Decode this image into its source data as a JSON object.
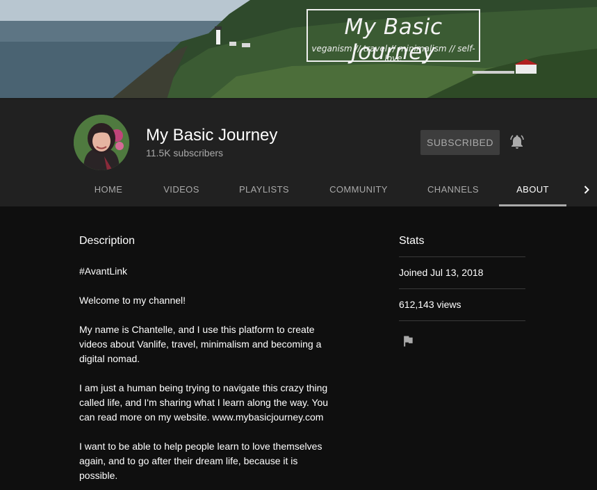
{
  "banner": {
    "title": "My Basic Journey",
    "tagline": "veganism // travel // minimalism // self-love"
  },
  "channel": {
    "name": "My Basic Journey",
    "subscribers": "11.5K subscribers",
    "subscribe_label": "SUBSCRIBED"
  },
  "tabs": [
    "HOME",
    "VIDEOS",
    "PLAYLISTS",
    "COMMUNITY",
    "CHANNELS",
    "ABOUT"
  ],
  "active_tab": "ABOUT",
  "about": {
    "description_title": "Description",
    "paragraphs": [
      [
        "#AvantLink"
      ],
      [
        "Welcome to my channel!"
      ],
      [
        "My name is Chantelle, and I use this platform to create",
        "videos about Vanlife, travel, minimalism and becoming a",
        "digital nomad."
      ],
      [
        "I am just a human being trying to navigate this crazy thing",
        "called life, and I'm sharing what I learn along the way. You",
        "can read more on my website. www.mybasicjourney.com"
      ],
      [
        "I want to be able to help people learn to love themselves",
        "again, and to go after their dream life, because it is",
        "possible."
      ]
    ],
    "stats_title": "Stats",
    "joined": "Joined Jul 13, 2018",
    "views": "612,143 views"
  },
  "icons": {
    "notifications": "bell-icon",
    "next_tabs": "chevron-right-icon",
    "report": "flag-icon"
  },
  "colors": {
    "page_bg": "#0f0f0f",
    "header_bg": "#212121",
    "subscribed_bg": "#3d3d3d",
    "muted_text": "#aaaaaa"
  }
}
